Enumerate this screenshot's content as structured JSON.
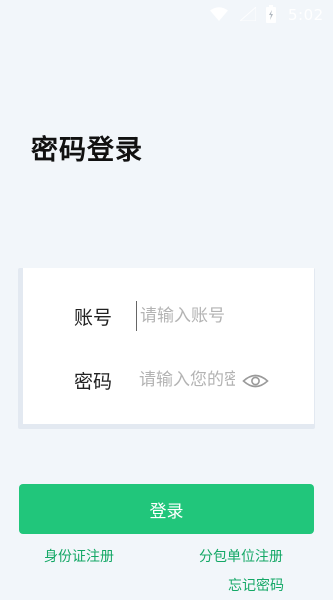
{
  "status_bar": {
    "time": "5:02",
    "icons": [
      "wifi-icon",
      "signal-icon",
      "battery-icon"
    ]
  },
  "page": {
    "title": "密码登录"
  },
  "form": {
    "account_label": "账号",
    "account_placeholder": "请输入账号",
    "password_label": "密码",
    "password_placeholder": "请输入您的密码",
    "visibility_icon": "eye-icon"
  },
  "actions": {
    "login_label": "登录",
    "personal_register": "身份证注册",
    "unit_register": "分包单位注册",
    "forgot_password": "忘记密码"
  },
  "colors": {
    "background": "#f2f6fa",
    "accent": "#21c67b",
    "link": "#14a866"
  }
}
